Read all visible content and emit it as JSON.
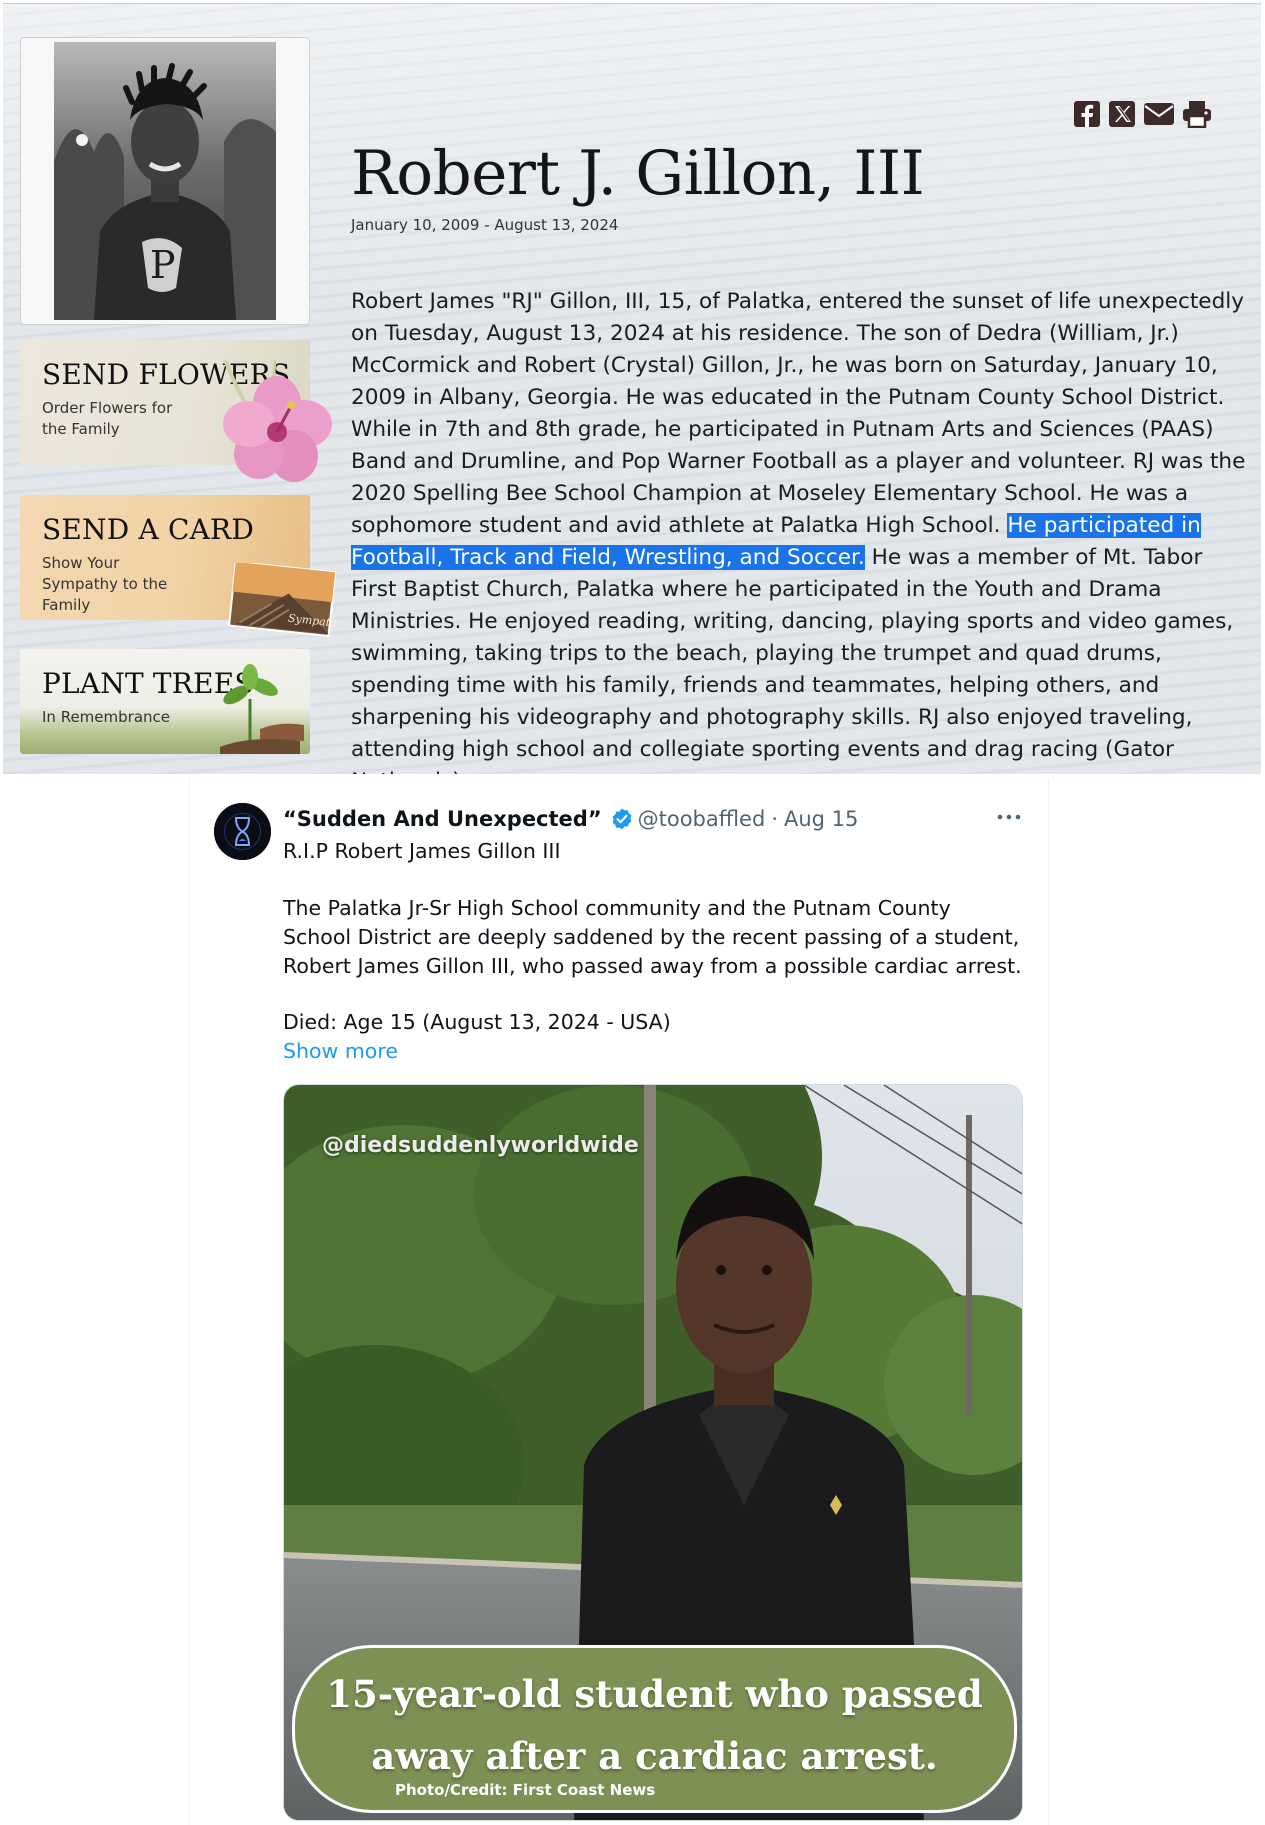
{
  "obituary": {
    "name": "Robert J. Gillon, III",
    "dates": "January 10, 2009 - August 13, 2024",
    "share_icons": [
      "facebook-icon",
      "x-icon",
      "email-icon",
      "print-icon"
    ],
    "promos": {
      "flowers": {
        "title": "SEND FLOWERS",
        "subtitle": "Order Flowers for the Family"
      },
      "card": {
        "title": "SEND A CARD",
        "subtitle": "Show Your Sympathy to the Family",
        "card_text": "Sympathy"
      },
      "trees": {
        "title": "PLANT TREES",
        "subtitle": "In Remembrance"
      }
    },
    "body_before": "Robert James \"RJ\" Gillon, III, 15, of Palatka, entered the sunset of life unexpectedly on Tuesday, August 13, 2024 at his residence. The son of Dedra (William, Jr.) McCormick and Robert (Crystal) Gillon, Jr., he was born on Saturday, January 10, 2009 in Albany, Georgia. He was educated in the Putnam County School District. While in 7th and 8th grade, he participated in Putnam Arts and Sciences (PAAS) Band and Drumline, and Pop Warner Football as a player and volunteer. RJ was the 2020 Spelling Bee School Champion at Moseley Elementary School. He was a sophomore student and avid athlete at Palatka High School. ",
    "body_highlight": "He participated in Football, Track and Field, Wrestling, and Soccer.",
    "body_after": " He was a member of Mt. Tabor First Baptist Church, Palatka where he participated in the Youth and Drama Ministries. He enjoyed reading, writing, dancing, playing sports and video games, swimming, taking trips to the beach, playing the trumpet and quad drums, spending time with his family, friends and teammates, helping others, and sharpening his videography and photography skills. RJ also enjoyed traveling, attending high school and collegiate sporting events and drag racing (Gator Nationals)."
  },
  "tweet": {
    "display_name": "“Sudden And Unexpected”",
    "handle": "@toobaffled",
    "separator": "·",
    "date": "Aug 15",
    "line1": "R.I.P Robert James Gillon III",
    "paragraph": "The Palatka Jr-Sr High School community and the Putnam County School District are deeply saddened by the recent passing of a student, Robert James Gillon III, who passed away from a possible cardiac arrest.",
    "died": "Died: Age 15 (August 13, 2024 - USA)",
    "show_more": "Show more",
    "image": {
      "watermark": "@diedsuddenlyworldwide",
      "caption_line1": "15-year-old student who passed",
      "caption_line2": "away after a cardiac arrest.",
      "credit": "Photo/Credit: First Coast News"
    },
    "colors": {
      "verified": "#1d9bf0",
      "link": "#1d9bf0",
      "highlight": "#1a73e8"
    }
  }
}
